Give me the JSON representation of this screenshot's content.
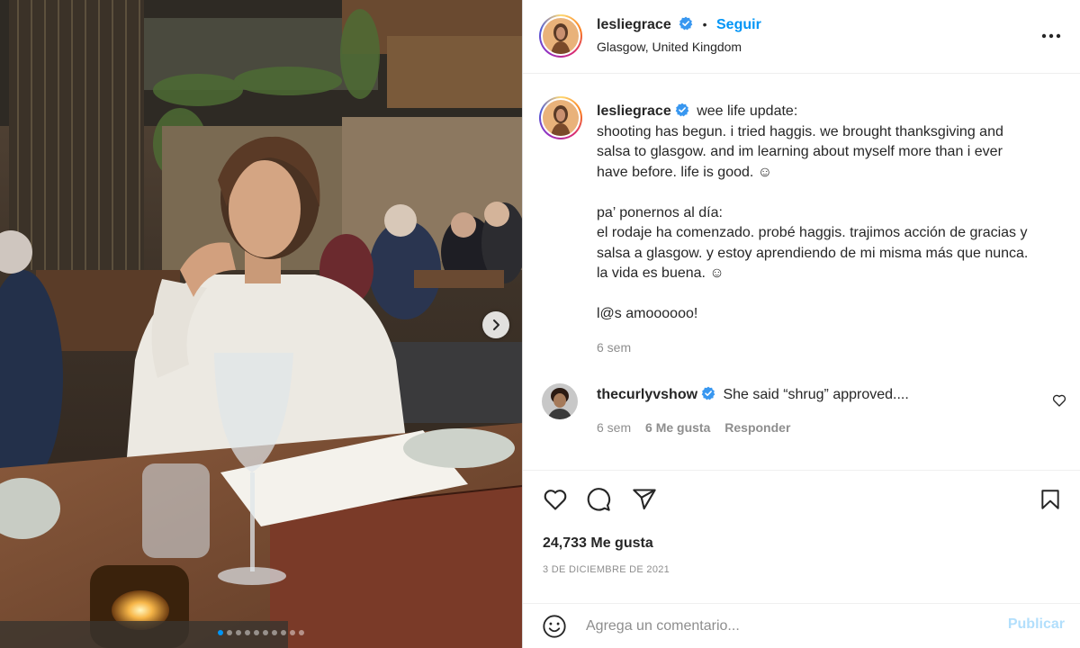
{
  "post": {
    "author": {
      "username": "lesliegrace",
      "location": "Glasgow, United Kingdom",
      "follow_label": "Seguir",
      "separator": "•"
    },
    "caption": {
      "username": "lesliegrace",
      "lines": [
        "wee life update:",
        "shooting has begun. i tried haggis. we brought thanksgiving and",
        "salsa to glasgow. and im learning about myself more than i ever",
        "have before. life is good. ☺",
        "",
        "pa’ ponernos al día:",
        "el rodaje ha comenzado. probé haggis. trajimos acción de gracias y",
        "salsa a glasgow. y estoy aprendiendo de mi misma más que nunca.",
        "la vida es buena. ☺",
        "",
        "l@s amoooooo!"
      ],
      "time": "6 sem"
    },
    "comments": [
      {
        "username": "thecurlyvshow",
        "text": "She said “shrug” approved....",
        "time": "6 sem",
        "likes": "6 Me gusta",
        "reply_label": "Responder"
      }
    ],
    "likes_label": "24,733 Me gusta",
    "date": "3 DE DICIEMBRE DE 2021",
    "comment_input": {
      "placeholder": "Agrega un comentario...",
      "publish_label": "Publicar"
    },
    "carousel": {
      "total": 10,
      "current": 1
    }
  },
  "icons": {
    "verified": "verified-badge-icon",
    "more": "more-horizontal-icon",
    "like": "heart-icon",
    "comment": "comment-bubble-icon",
    "share": "paper-plane-icon",
    "save": "bookmark-icon",
    "emoji": "emoji-smile-icon",
    "next": "chevron-right-icon"
  },
  "colors": {
    "link_blue": "#0095f6",
    "verified_blue": "#3897f0",
    "muted_text": "#8e8e8e",
    "publish_disabled": "#b2dffc"
  }
}
